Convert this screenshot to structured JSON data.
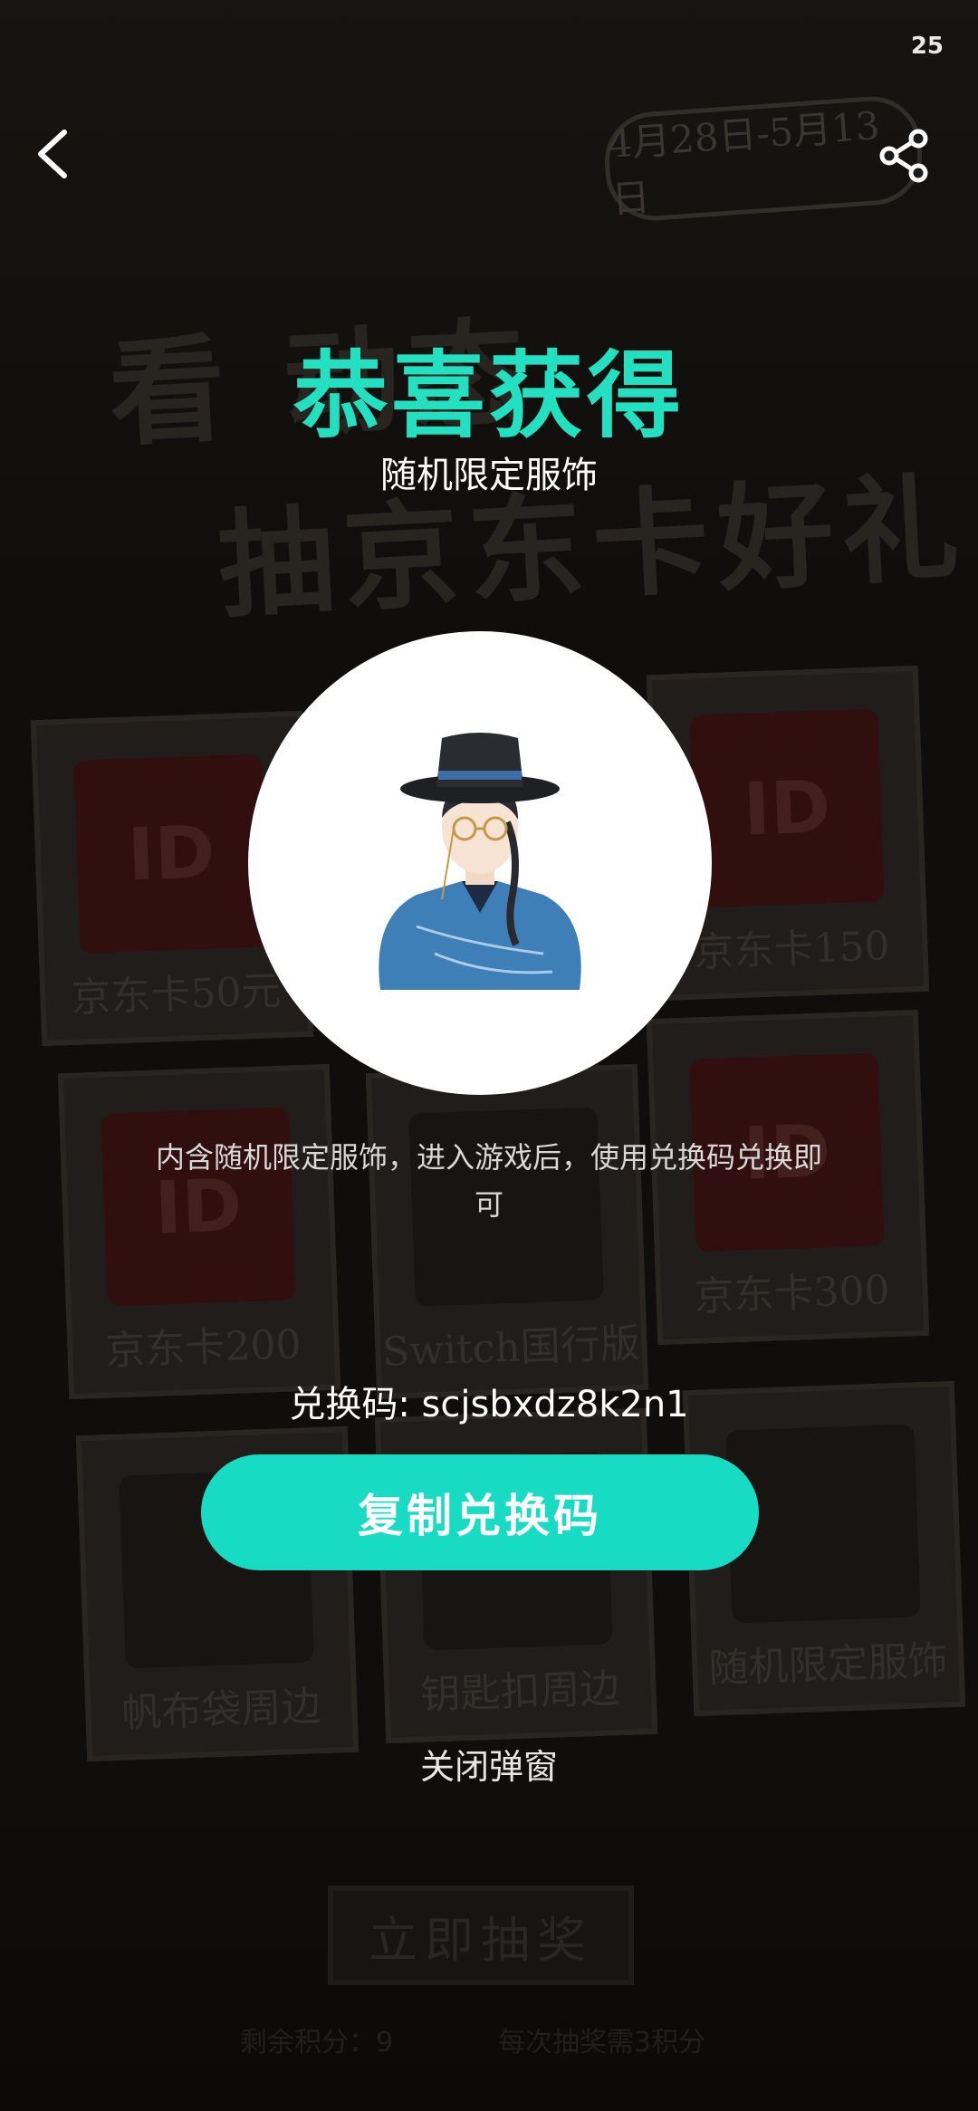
{
  "status": {
    "time": "25"
  },
  "background": {
    "date_badge": "4月28日-5月13日",
    "headline_line1": "看 动态",
    "headline_line2": "抽京东卡好礼",
    "cards": [
      {
        "pic": "ID",
        "caption": "京东卡50元"
      },
      {
        "pic": "ID",
        "caption": "京东卡150"
      },
      {
        "pic": "ID",
        "caption": "京东卡200"
      },
      {
        "pic": "",
        "caption": "Switch国行版"
      },
      {
        "pic": "ID",
        "caption": "京东卡300"
      },
      {
        "pic": "",
        "caption": "帆布袋周边"
      },
      {
        "pic": "",
        "caption": "钥匙扣周边"
      },
      {
        "pic": "",
        "caption": "随机限定服饰"
      }
    ],
    "draw_button": "立即抽奖",
    "points_left": "剩余积分：9",
    "cost_text": "每次抽奖需3积分"
  },
  "dialog": {
    "title": "恭喜获得",
    "prize_name": "随机限定服饰",
    "description": "内含随机限定服饰，进入游戏后，使用兑换码兑换即可",
    "code_label": "兑换码: scjsbxdz8k2n1",
    "copy_button": "复制兑换码",
    "close_link": "关闭弹窗"
  },
  "colors": {
    "accent": "#22e0c0",
    "button": "#17dcc3"
  },
  "icons": {
    "back": "chevron-left-icon",
    "share": "share-icon",
    "prize": "character-avatar-icon"
  }
}
